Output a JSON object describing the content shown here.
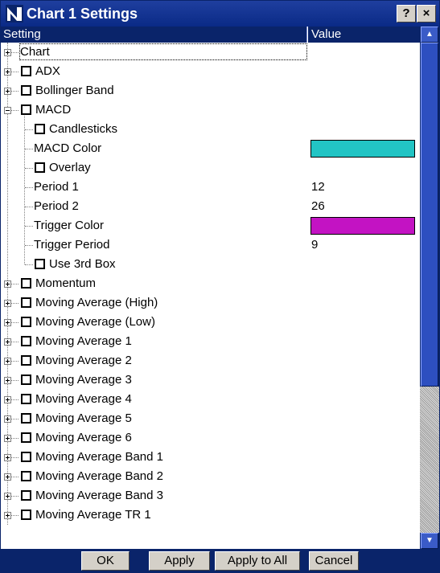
{
  "window": {
    "title": "Chart 1 Settings",
    "help_label": "?",
    "close_label": "×"
  },
  "columns": {
    "setting": "Setting",
    "value": "Value"
  },
  "tree": [
    {
      "label": "Chart",
      "depth": 0,
      "expander": "plus",
      "checkbox": false
    },
    {
      "label": "ADX",
      "depth": 0,
      "expander": "plus",
      "checkbox": true
    },
    {
      "label": "Bollinger Band",
      "depth": 0,
      "expander": "plus",
      "checkbox": true
    },
    {
      "label": "MACD",
      "depth": 0,
      "expander": "minus",
      "checkbox": true
    },
    {
      "label": "Candlesticks",
      "depth": 1,
      "checkbox": true
    },
    {
      "label": "MACD Color",
      "depth": 1,
      "checkbox": false,
      "color": "#22c4c4"
    },
    {
      "label": "Overlay",
      "depth": 1,
      "checkbox": true
    },
    {
      "label": "Period 1",
      "depth": 1,
      "checkbox": false,
      "value": "12"
    },
    {
      "label": "Period 2",
      "depth": 1,
      "checkbox": false,
      "value": "26"
    },
    {
      "label": "Trigger Color",
      "depth": 1,
      "checkbox": false,
      "color": "#c313c3"
    },
    {
      "label": "Trigger Period",
      "depth": 1,
      "checkbox": false,
      "value": "9"
    },
    {
      "label": "Use 3rd Box",
      "depth": 1,
      "checkbox": true
    },
    {
      "label": "Momentum",
      "depth": 0,
      "expander": "plus",
      "checkbox": true
    },
    {
      "label": "Moving Average (High)",
      "depth": 0,
      "expander": "plus",
      "checkbox": true
    },
    {
      "label": "Moving Average (Low)",
      "depth": 0,
      "expander": "plus",
      "checkbox": true
    },
    {
      "label": "Moving Average 1",
      "depth": 0,
      "expander": "plus",
      "checkbox": true
    },
    {
      "label": "Moving Average 2",
      "depth": 0,
      "expander": "plus",
      "checkbox": true
    },
    {
      "label": "Moving Average 3",
      "depth": 0,
      "expander": "plus",
      "checkbox": true
    },
    {
      "label": "Moving Average 4",
      "depth": 0,
      "expander": "plus",
      "checkbox": true
    },
    {
      "label": "Moving Average 5",
      "depth": 0,
      "expander": "plus",
      "checkbox": true
    },
    {
      "label": "Moving Average 6",
      "depth": 0,
      "expander": "plus",
      "checkbox": true
    },
    {
      "label": "Moving Average Band 1",
      "depth": 0,
      "expander": "plus",
      "checkbox": true
    },
    {
      "label": "Moving Average Band 2",
      "depth": 0,
      "expander": "plus",
      "checkbox": true
    },
    {
      "label": "Moving Average Band 3",
      "depth": 0,
      "expander": "plus",
      "checkbox": true
    },
    {
      "label": "Moving Average TR 1",
      "depth": 0,
      "expander": "plus",
      "checkbox": true
    }
  ],
  "buttons": {
    "ok": "OK",
    "apply": "Apply",
    "apply_all": "Apply to All",
    "cancel": "Cancel"
  },
  "scrollbar": {
    "up_icon": "▲",
    "down_icon": "▼"
  },
  "colors": {
    "titlebar": "#0a2a86",
    "header": "#0a246a",
    "macd_color": "#22c4c4",
    "trigger_color": "#c313c3"
  }
}
